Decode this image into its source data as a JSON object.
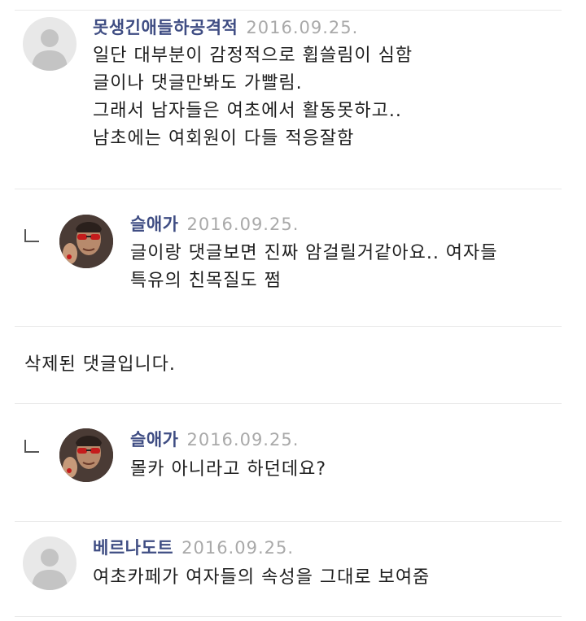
{
  "comments": [
    {
      "author": "못생긴애들하공격적",
      "date": "2016.09.25.",
      "lines": [
        "일단 대부분이 감정적으로 휩쓸림이 심함",
        "글이나 댓글만봐도 가빨림.",
        "그래서 남자들은 여초에서 활동못하고..",
        "남초에는 여회원이 다들 적응잘함"
      ]
    },
    {
      "author": "슬애가",
      "date": "2016.09.25.",
      "lines": [
        "글이랑 댓글보면 진짜 암걸릴거같아요.. 여자들",
        "특유의 친목질도 쩜"
      ]
    },
    {
      "deleted_text": "삭제된 댓글입니다."
    },
    {
      "author": "슬애가",
      "date": "2016.09.25.",
      "lines": [
        "몰카 아니라고 하던데요?"
      ]
    },
    {
      "author": "베르나도트",
      "date": "2016.09.25.",
      "lines": [
        "여초카페가 여자들의 속성을 그대로 보여줌"
      ]
    }
  ]
}
